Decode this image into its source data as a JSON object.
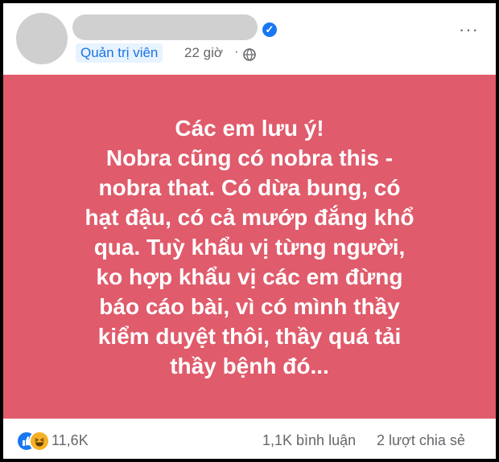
{
  "post": {
    "role_badge": "Quản trị viên",
    "time": "22 giờ",
    "separator": "·",
    "more": "···"
  },
  "banner": {
    "lines": [
      "Các em lưu ý!",
      "Nobra cũng có nobra this - nobra that. Có dừa bung, có hạt đậu, có cả mướp đắng khổ qua. Tuỳ khẩu vị từng người, ko hợp khẩu vị các em đừng báo cáo bài, vì có mình thầy kiểm duyệt thôi, thầy quá tải thầy bệnh đó..."
    ],
    "background": "#e05b6b"
  },
  "footer": {
    "reaction_count": "11,6K",
    "comments": "1,1K bình luận",
    "shares": "2 lượt chia sẻ"
  },
  "icons": {
    "like": "like-icon",
    "haha": "haha-icon",
    "globe": "globe-icon",
    "verified": "verified-badge-icon"
  }
}
